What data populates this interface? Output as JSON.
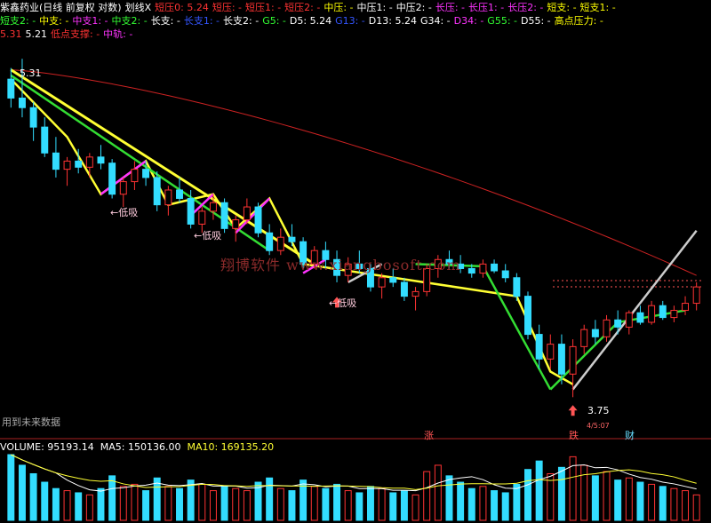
{
  "header": {
    "row1": [
      {
        "text": "紫鑫药业(日线 前复权 对数)",
        "color": "#ffffff"
      },
      {
        "text": "划线X",
        "color": "#ffffff"
      },
      {
        "text": "短压0: 5.24",
        "color": "#ff3333"
      },
      {
        "text": "短压: -",
        "color": "#ff3333"
      },
      {
        "text": "短压1: -",
        "color": "#ff3333"
      },
      {
        "text": "短压2: -",
        "color": "#ff3333"
      },
      {
        "text": "中压: -",
        "color": "#ffff00"
      },
      {
        "text": "中压1: -",
        "color": "#ffffff"
      },
      {
        "text": "中压2: -",
        "color": "#ffffff"
      },
      {
        "text": "长压: -",
        "color": "#ff33ff"
      },
      {
        "text": "长压1: -",
        "color": "#ff33ff"
      },
      {
        "text": "长压2: -",
        "color": "#ff33ff"
      },
      {
        "text": "短支: -",
        "color": "#ffff00"
      },
      {
        "text": "短支1: -",
        "color": "#ffff00"
      }
    ],
    "row2": [
      {
        "text": "短支2: -",
        "color": "#33ff33"
      },
      {
        "text": "中支: -",
        "color": "#ffff00"
      },
      {
        "text": "中支1: -",
        "color": "#ff33ff"
      },
      {
        "text": "中支2: -",
        "color": "#33ff33"
      },
      {
        "text": "长支: -",
        "color": "#ffffff"
      },
      {
        "text": "长支1: -",
        "color": "#3355ff"
      },
      {
        "text": "长支2: -",
        "color": "#ffffff"
      },
      {
        "text": "G5: -",
        "color": "#33ff33"
      },
      {
        "text": "D5: 5.24",
        "color": "#ffffff"
      },
      {
        "text": "G13: -",
        "color": "#3355ff"
      },
      {
        "text": "D13: 5.24",
        "color": "#ffffff"
      },
      {
        "text": "G34: -",
        "color": "#ffffff"
      },
      {
        "text": "D34: -",
        "color": "#ff33ff"
      },
      {
        "text": "G55: -",
        "color": "#33ff33"
      },
      {
        "text": "D55: -",
        "color": "#ffffff"
      },
      {
        "text": "高点压力: -",
        "color": "#ffff00"
      }
    ],
    "row3": [
      {
        "text": "5.31",
        "color": "#ff3333"
      },
      {
        "text": "5.21",
        "color": "#ffffff"
      },
      {
        "text": "低点支撑: -",
        "color": "#ff3333"
      },
      {
        "text": "中轨: -",
        "color": "#ff33ff"
      }
    ]
  },
  "watermark": "翔博软件 www.xiangbosoft.com",
  "annotations": {
    "low_suck": "←低吸",
    "top_price": "5.31",
    "bottom_price": "3.75",
    "future_data": "用到未来数据",
    "marker_up": "涨",
    "marker_down": "跌",
    "marker_fin": "财",
    "marker_small": "4/5:07"
  },
  "volume_header": {
    "volume": "VOLUME: 95193.14",
    "ma5": "MA5: 150136.00",
    "ma10": "MA10: 169135.20"
  },
  "colors": {
    "up": "#ff3333",
    "down": "#33ddff",
    "ma_long": "#cc2222",
    "line_yellow": "#ffff33",
    "line_green": "#33dd33",
    "line_magenta": "#ff33ff",
    "line_white": "#cccccc"
  },
  "chart_data": {
    "type": "candlestick",
    "title": "紫鑫药业(日线 前复权 对数)",
    "price_range": [
      3.75,
      5.31
    ],
    "ohlc": [
      [
        5.2,
        5.26,
        5.05,
        5.1
      ],
      [
        5.1,
        5.31,
        5.0,
        5.05
      ],
      [
        5.05,
        5.08,
        4.88,
        4.95
      ],
      [
        4.95,
        5.0,
        4.8,
        4.82
      ],
      [
        4.82,
        4.9,
        4.7,
        4.74
      ],
      [
        4.74,
        4.8,
        4.66,
        4.78
      ],
      [
        4.78,
        4.84,
        4.72,
        4.75
      ],
      [
        4.75,
        4.82,
        4.7,
        4.8
      ],
      [
        4.8,
        4.86,
        4.74,
        4.77
      ],
      [
        4.77,
        4.79,
        4.6,
        4.62
      ],
      [
        4.62,
        4.7,
        4.56,
        4.68
      ],
      [
        4.68,
        4.78,
        4.64,
        4.74
      ],
      [
        4.74,
        4.78,
        4.66,
        4.7
      ],
      [
        4.7,
        4.73,
        4.54,
        4.57
      ],
      [
        4.57,
        4.66,
        4.52,
        4.64
      ],
      [
        4.64,
        4.7,
        4.58,
        4.6
      ],
      [
        4.6,
        4.64,
        4.46,
        4.48
      ],
      [
        4.48,
        4.56,
        4.44,
        4.54
      ],
      [
        4.54,
        4.62,
        4.5,
        4.58
      ],
      [
        4.58,
        4.6,
        4.44,
        4.46
      ],
      [
        4.46,
        4.52,
        4.4,
        4.5
      ],
      [
        4.5,
        4.6,
        4.48,
        4.56
      ],
      [
        4.56,
        4.58,
        4.42,
        4.44
      ],
      [
        4.44,
        4.48,
        4.34,
        4.36
      ],
      [
        4.36,
        4.46,
        4.34,
        4.42
      ],
      [
        4.42,
        4.48,
        4.38,
        4.4
      ],
      [
        4.4,
        4.42,
        4.28,
        4.3
      ],
      [
        4.3,
        4.38,
        4.28,
        4.36
      ],
      [
        4.36,
        4.4,
        4.28,
        4.32
      ],
      [
        4.32,
        4.36,
        4.22,
        4.25
      ],
      [
        4.25,
        4.33,
        4.22,
        4.3
      ],
      [
        4.3,
        4.36,
        4.26,
        4.28
      ],
      [
        4.28,
        4.3,
        4.18,
        4.2
      ],
      [
        4.2,
        4.26,
        4.15,
        4.24
      ],
      [
        4.24,
        4.28,
        4.2,
        4.22
      ],
      [
        4.22,
        4.24,
        4.14,
        4.16
      ],
      [
        4.16,
        4.2,
        4.1,
        4.18
      ],
      [
        4.18,
        4.3,
        4.16,
        4.28
      ],
      [
        4.28,
        4.34,
        4.24,
        4.32
      ],
      [
        4.32,
        4.36,
        4.28,
        4.3
      ],
      [
        4.3,
        4.34,
        4.26,
        4.28
      ],
      [
        4.28,
        4.3,
        4.24,
        4.26
      ],
      [
        4.26,
        4.32,
        4.24,
        4.3
      ],
      [
        4.3,
        4.32,
        4.26,
        4.27
      ],
      [
        4.27,
        4.3,
        4.22,
        4.24
      ],
      [
        4.24,
        4.26,
        4.14,
        4.16
      ],
      [
        4.16,
        4.18,
        3.98,
        4.0
      ],
      [
        4.0,
        4.04,
        3.86,
        3.9
      ],
      [
        3.9,
        4.0,
        3.86,
        3.96
      ],
      [
        3.96,
        4.0,
        3.8,
        3.84
      ],
      [
        3.84,
        3.98,
        3.75,
        3.95
      ],
      [
        3.95,
        4.04,
        3.92,
        4.02
      ],
      [
        4.02,
        4.06,
        3.96,
        3.99
      ],
      [
        3.99,
        4.08,
        3.97,
        4.06
      ],
      [
        4.06,
        4.1,
        4.0,
        4.03
      ],
      [
        4.03,
        4.1,
        4.0,
        4.09
      ],
      [
        4.09,
        4.12,
        4.04,
        4.05
      ],
      [
        4.05,
        4.14,
        4.04,
        4.12
      ],
      [
        4.12,
        4.14,
        4.06,
        4.07
      ],
      [
        4.07,
        4.12,
        4.05,
        4.1
      ],
      [
        4.1,
        4.16,
        4.08,
        4.13
      ],
      [
        4.13,
        4.22,
        4.1,
        4.2
      ]
    ],
    "volume": [
      310,
      260,
      220,
      180,
      150,
      140,
      130,
      120,
      150,
      210,
      160,
      170,
      140,
      200,
      160,
      150,
      190,
      170,
      140,
      160,
      150,
      140,
      180,
      200,
      150,
      140,
      190,
      160,
      150,
      170,
      140,
      130,
      160,
      150,
      130,
      140,
      120,
      230,
      260,
      210,
      180,
      150,
      160,
      140,
      130,
      170,
      240,
      280,
      220,
      250,
      300,
      260,
      210,
      230,
      190,
      200,
      180,
      170,
      160,
      150,
      140,
      120
    ]
  }
}
